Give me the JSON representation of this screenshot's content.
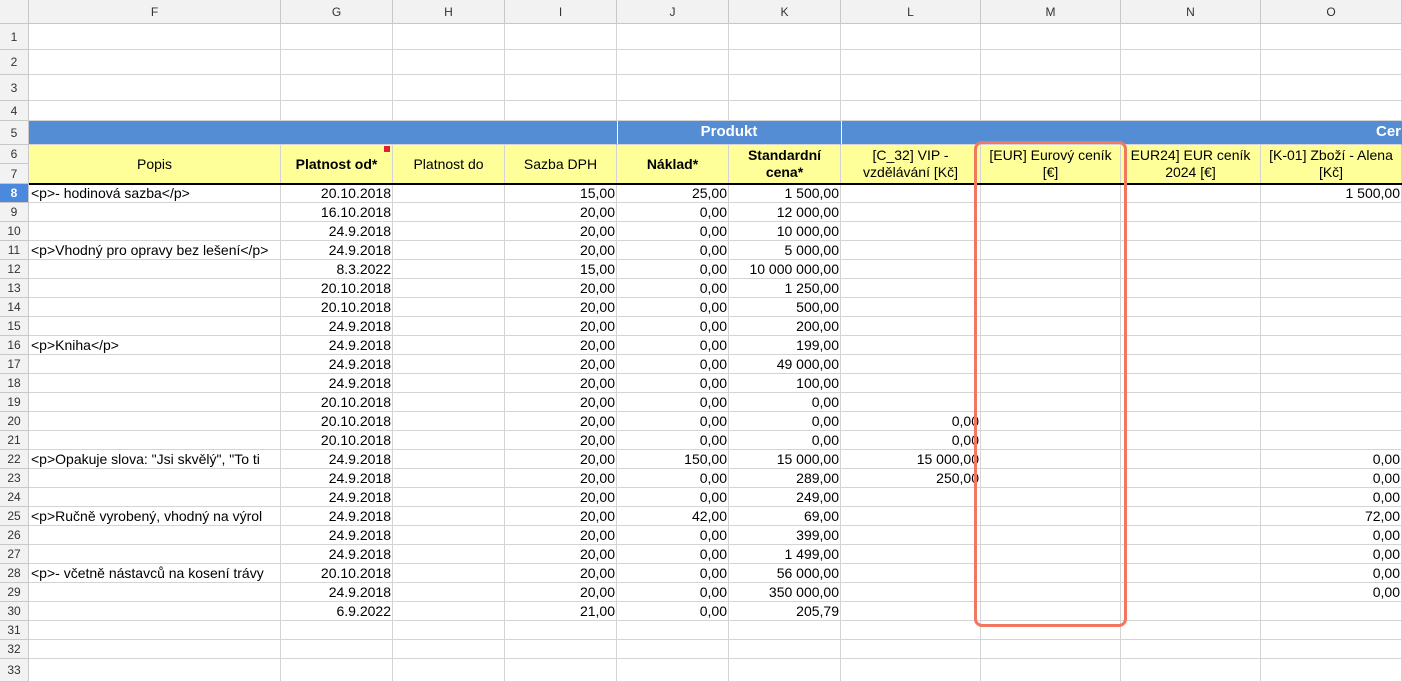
{
  "columns": [
    "F",
    "G",
    "H",
    "I",
    "J",
    "K",
    "L",
    "M",
    "N",
    "O"
  ],
  "row_numbers": [
    "1",
    "2",
    "3",
    "4",
    "5",
    "6",
    "7",
    "8",
    "9",
    "10",
    "11",
    "12",
    "13",
    "14",
    "15",
    "16",
    "17",
    "18",
    "19",
    "20",
    "21",
    "22",
    "23",
    "24",
    "25",
    "26",
    "27",
    "28",
    "29",
    "30",
    "31",
    "32",
    "33"
  ],
  "selected_row": "8",
  "band": {
    "produkt": "Produkt",
    "cenik": "Cer"
  },
  "headers": {
    "popis": "Popis",
    "platnost_od": "Platnost od*",
    "platnost_do": "Platnost do",
    "sazba_dph": "Sazba DPH",
    "naklad": "Náklad*",
    "standardni_cena": "Standardní cena*",
    "vip": "[C_32] VIP - vzdělávání [Kč]",
    "eur": "[EUR] Eurový ceník [€]",
    "eur24": "EUR24] EUR ceník 2024 [€]",
    "k01": "[K-01] Zboží - Alena [Kč]"
  },
  "rows": [
    {
      "popis": "<p>- hodinová sazba</p>",
      "od": "20.10.2018",
      "sazba": "15,00",
      "naklad": "25,00",
      "cena": "1 500,00",
      "vip": "",
      "k01": "1 500,00"
    },
    {
      "popis": "",
      "od": "16.10.2018",
      "sazba": "20,00",
      "naklad": "0,00",
      "cena": "12 000,00",
      "vip": "",
      "k01": ""
    },
    {
      "popis": "",
      "od": "24.9.2018",
      "sazba": "20,00",
      "naklad": "0,00",
      "cena": "10 000,00",
      "vip": "",
      "k01": ""
    },
    {
      "popis": "<p>Vhodný pro opravy bez lešení</p>",
      "od": "24.9.2018",
      "sazba": "20,00",
      "naklad": "0,00",
      "cena": "5 000,00",
      "vip": "",
      "k01": ""
    },
    {
      "popis": "",
      "od": "8.3.2022",
      "sazba": "15,00",
      "naklad": "0,00",
      "cena": "10 000 000,00",
      "vip": "",
      "k01": ""
    },
    {
      "popis": "",
      "od": "20.10.2018",
      "sazba": "20,00",
      "naklad": "0,00",
      "cena": "1 250,00",
      "vip": "",
      "k01": ""
    },
    {
      "popis": "",
      "od": "20.10.2018",
      "sazba": "20,00",
      "naklad": "0,00",
      "cena": "500,00",
      "vip": "",
      "k01": ""
    },
    {
      "popis": "",
      "od": "24.9.2018",
      "sazba": "20,00",
      "naklad": "0,00",
      "cena": "200,00",
      "vip": "",
      "k01": ""
    },
    {
      "popis": "<p>Kniha</p>",
      "od": "24.9.2018",
      "sazba": "20,00",
      "naklad": "0,00",
      "cena": "199,00",
      "vip": "",
      "k01": ""
    },
    {
      "popis": "",
      "od": "24.9.2018",
      "sazba": "20,00",
      "naklad": "0,00",
      "cena": "49 000,00",
      "vip": "",
      "k01": ""
    },
    {
      "popis": "",
      "od": "24.9.2018",
      "sazba": "20,00",
      "naklad": "0,00",
      "cena": "100,00",
      "vip": "",
      "k01": ""
    },
    {
      "popis": "",
      "od": "20.10.2018",
      "sazba": "20,00",
      "naklad": "0,00",
      "cena": "0,00",
      "vip": "",
      "k01": ""
    },
    {
      "popis": "",
      "od": "20.10.2018",
      "sazba": "20,00",
      "naklad": "0,00",
      "cena": "0,00",
      "vip": "0,00",
      "k01": ""
    },
    {
      "popis": "",
      "od": "20.10.2018",
      "sazba": "20,00",
      "naklad": "0,00",
      "cena": "0,00",
      "vip": "0,00",
      "k01": ""
    },
    {
      "popis": "<p>Opakuje slova: \"Jsi skvělý\", \"To ti",
      "od": "24.9.2018",
      "sazba": "20,00",
      "naklad": "150,00",
      "cena": "15 000,00",
      "vip": "15 000,00",
      "k01": "0,00"
    },
    {
      "popis": "",
      "od": "24.9.2018",
      "sazba": "20,00",
      "naklad": "0,00",
      "cena": "289,00",
      "vip": "250,00",
      "k01": "0,00"
    },
    {
      "popis": "",
      "od": "24.9.2018",
      "sazba": "20,00",
      "naklad": "0,00",
      "cena": "249,00",
      "vip": "",
      "k01": "0,00"
    },
    {
      "popis": "<p>Ručně vyrobený, vhodný na výrol",
      "od": "24.9.2018",
      "sazba": "20,00",
      "naklad": "42,00",
      "cena": "69,00",
      "vip": "",
      "k01": "72,00"
    },
    {
      "popis": "",
      "od": "24.9.2018",
      "sazba": "20,00",
      "naklad": "0,00",
      "cena": "399,00",
      "vip": "",
      "k01": "0,00"
    },
    {
      "popis": "",
      "od": "24.9.2018",
      "sazba": "20,00",
      "naklad": "0,00",
      "cena": "1 499,00",
      "vip": "",
      "k01": "0,00"
    },
    {
      "popis": "<p>- včetně nástavců na kosení trávy",
      "od": "20.10.2018",
      "sazba": "20,00",
      "naklad": "0,00",
      "cena": "56 000,00",
      "vip": "",
      "k01": "0,00"
    },
    {
      "popis": "",
      "od": "24.9.2018",
      "sazba": "20,00",
      "naklad": "0,00",
      "cena": "350 000,00",
      "vip": "",
      "k01": "0,00"
    },
    {
      "popis": "",
      "od": "6.9.2022",
      "sazba": "21,00",
      "naklad": "0,00",
      "cena": "205,79",
      "vip": "",
      "k01": ""
    }
  ],
  "colors": {
    "header_band": "#548dd4",
    "header_fill": "#ffff99",
    "highlight": "#f07860",
    "selected_row": "#4a89dc"
  }
}
